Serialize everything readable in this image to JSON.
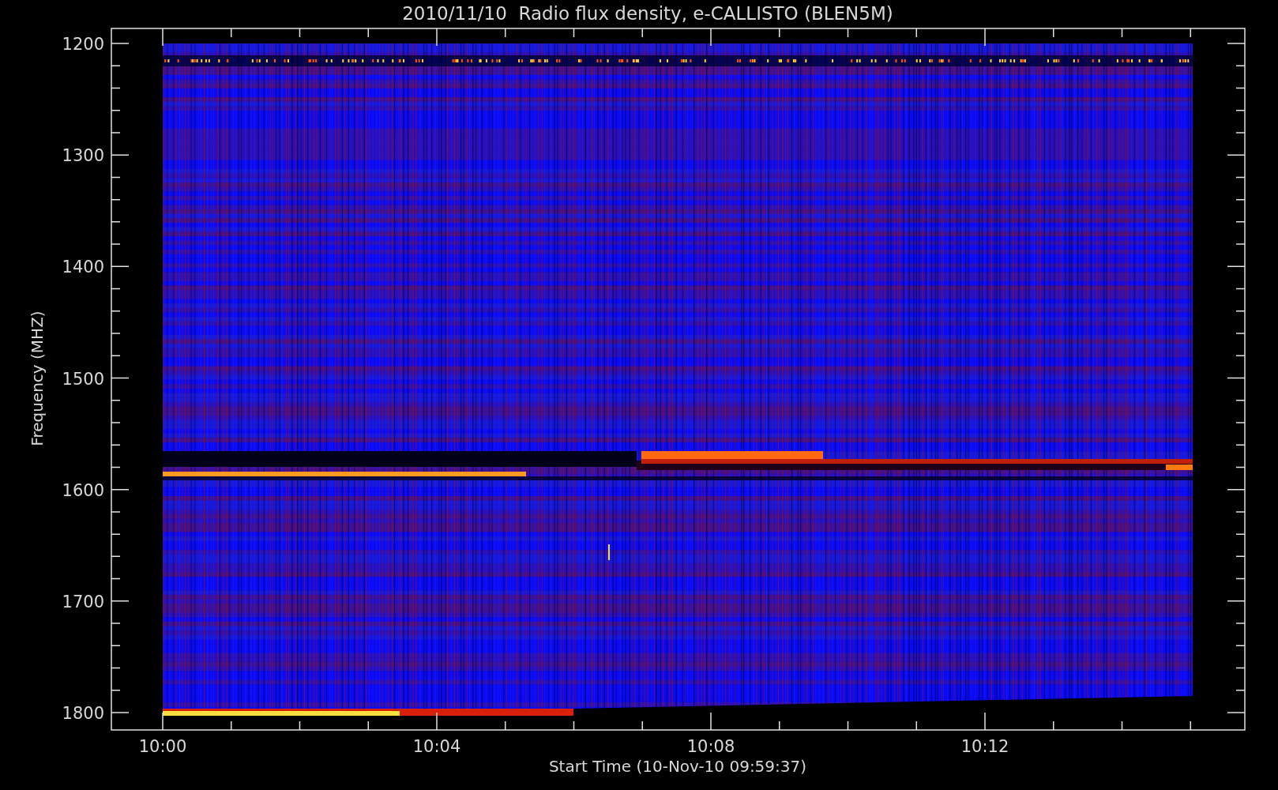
{
  "title": "2010/11/10  Radio flux density, e-CALLISTO (BLEN5M)",
  "y_axis": {
    "label": "Frequency (MHZ)",
    "ticks": [
      "1200",
      "1300",
      "1400",
      "1500",
      "1600",
      "1700",
      "1800"
    ]
  },
  "x_axis": {
    "label": "Start Time (10-Nov-10 09:59:37)",
    "ticks": [
      "10:00",
      "10:04",
      "10:08",
      "10:12"
    ]
  }
}
